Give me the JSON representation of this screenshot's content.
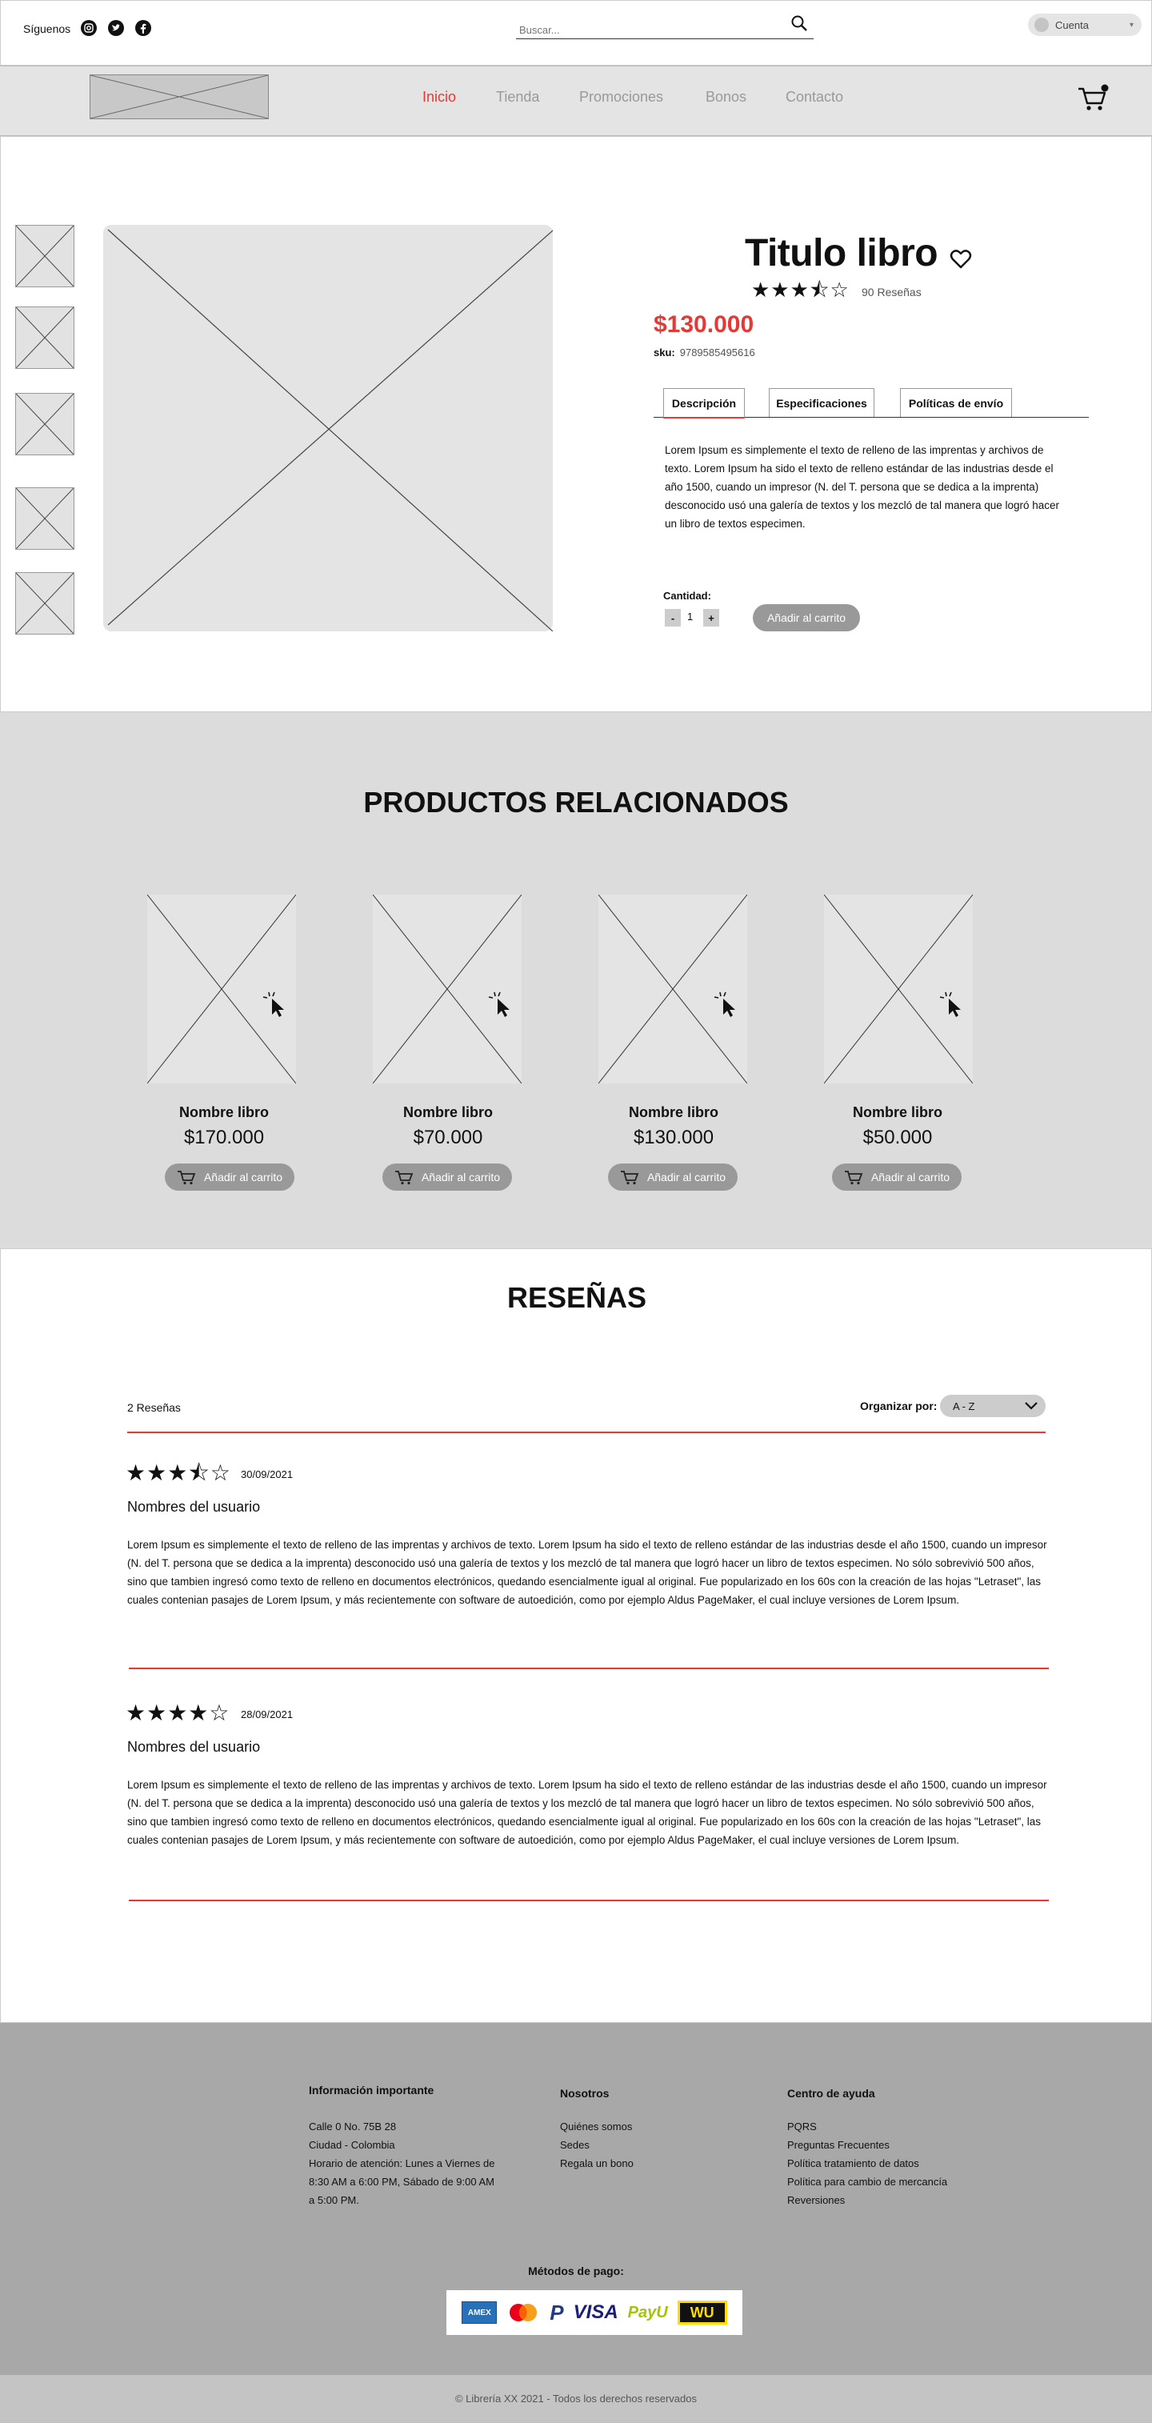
{
  "topbar": {
    "follow_label": "Síguenos",
    "social_icons": [
      "instagram-icon",
      "twitter-icon",
      "facebook-icon"
    ],
    "search_placeholder": "Buscar...",
    "account_label": "Cuenta"
  },
  "nav": {
    "links": [
      "Inicio",
      "Tienda",
      "Promociones",
      "Bonos",
      "Contacto"
    ],
    "active": "Inicio",
    "active_color": "#e53935"
  },
  "product": {
    "title": "Titulo libro",
    "rating": 3.5,
    "stars": "★★★⯪☆",
    "reviews_count": "90 Reseñas",
    "price": "$130.000",
    "sku_label": "sku:",
    "sku_value": "9789585495616",
    "tabs": [
      "Descripción",
      "Especificaciones",
      "Políticas de envío"
    ],
    "active_tab": "Descripción",
    "description": "Lorem Ipsum es simplemente el texto de relleno de las imprentas y archivos de texto. Lorem Ipsum ha sido el texto de relleno estándar de las industrias desde el año 1500, cuando un impresor (N. del T. persona que se dedica a la imprenta) desconocido usó una galería de textos y los mezcló de tal manera que logró hacer un libro de textos especimen.",
    "quantity_label": "Cantidad:",
    "minus": "-",
    "quantity": "1",
    "plus": "+",
    "add_to_cart": "Añadir al carrito"
  },
  "related": {
    "title": "PRODUCTOS RELACIONADOS",
    "items": [
      {
        "name": "Nombre libro",
        "price": "$170.000",
        "button": "Añadir al carrito"
      },
      {
        "name": "Nombre libro",
        "price": "$70.000",
        "button": "Añadir al carrito"
      },
      {
        "name": "Nombre libro",
        "price": "$130.000",
        "button": "Añadir al carrito"
      },
      {
        "name": "Nombre libro",
        "price": "$50.000",
        "button": "Añadir al carrito"
      }
    ]
  },
  "reviews": {
    "title": "RESEÑAS",
    "count": "2 Reseñas",
    "sort_label": "Organizar por:",
    "sort_value": "A - Z",
    "items": [
      {
        "rating": 3.5,
        "stars": "★★★⯪☆",
        "date": "30/09/2021",
        "user": "Nombres del usuario",
        "text": "Lorem Ipsum es simplemente el texto de relleno de las imprentas y archivos de texto. Lorem Ipsum ha sido el texto de relleno estándar de las industrias desde el año 1500, cuando un impresor (N. del T. persona que se dedica a la imprenta) desconocido usó una galería de textos y los mezcló de tal manera que logró hacer un libro de textos especimen. No sólo sobrevivió 500 años, sino que tambien ingresó como texto de relleno en documentos electrónicos, quedando esencialmente igual al original. Fue popularizado en los 60s con la creación de las hojas \"Letraset\", las cuales contenian pasajes de Lorem Ipsum, y más recientemente con software de autoedición, como por ejemplo Aldus PageMaker, el cual incluye versiones de Lorem Ipsum."
      },
      {
        "rating": 4,
        "stars": "★★★★☆",
        "date": "28/09/2021",
        "user": "Nombres del usuario",
        "text": "Lorem Ipsum es simplemente el texto de relleno de las imprentas y archivos de texto. Lorem Ipsum ha sido el texto de relleno estándar de las industrias desde el año 1500, cuando un impresor (N. del T. persona que se dedica a la imprenta) desconocido usó una galería de textos y los mezcló de tal manera que logró hacer un libro de textos especimen. No sólo sobrevivió 500 años, sino que tambien ingresó como texto de relleno en documentos electrónicos, quedando esencialmente igual al original. Fue popularizado en los 60s con la creación de las hojas \"Letraset\", las cuales contenian pasajes de Lorem Ipsum, y más recientemente con software de autoedición, como por ejemplo Aldus PageMaker, el cual incluye versiones de Lorem Ipsum."
      }
    ]
  },
  "footer": {
    "info": {
      "title": "Información  importante",
      "lines": [
        "Calle 0 No. 75B 28",
        "Ciudad - Colombia",
        "Horario de atención: Lunes a Viernes de",
        "8:30 AM a 6:00 PM, Sábado de 9:00 AM",
        "a 5:00 PM."
      ]
    },
    "nosotros": {
      "title": "Nosotros",
      "lines": [
        "Quiénes somos",
        "Sedes",
        "Regala un bono"
      ]
    },
    "ayuda": {
      "title": "Centro de ayuda",
      "lines": [
        "PQRS",
        "Preguntas Frecuentes",
        "Política tratamiento de datos",
        "Política para cambio de mercancía",
        "Reversiones"
      ]
    },
    "payment_label": "Métodos de pago:",
    "payment_methods": {
      "amex": "AMEX",
      "paypal": "P",
      "visa": "VISA",
      "payu": "PayU",
      "wu": "WU"
    },
    "payment_icons": [
      "amex-icon",
      "mastercard-icon",
      "paypal-icon",
      "visa-icon",
      "payu-icon",
      "western-union-icon"
    ]
  },
  "copyright": "© Librería XX 2021 - Todos los derechos reservados"
}
